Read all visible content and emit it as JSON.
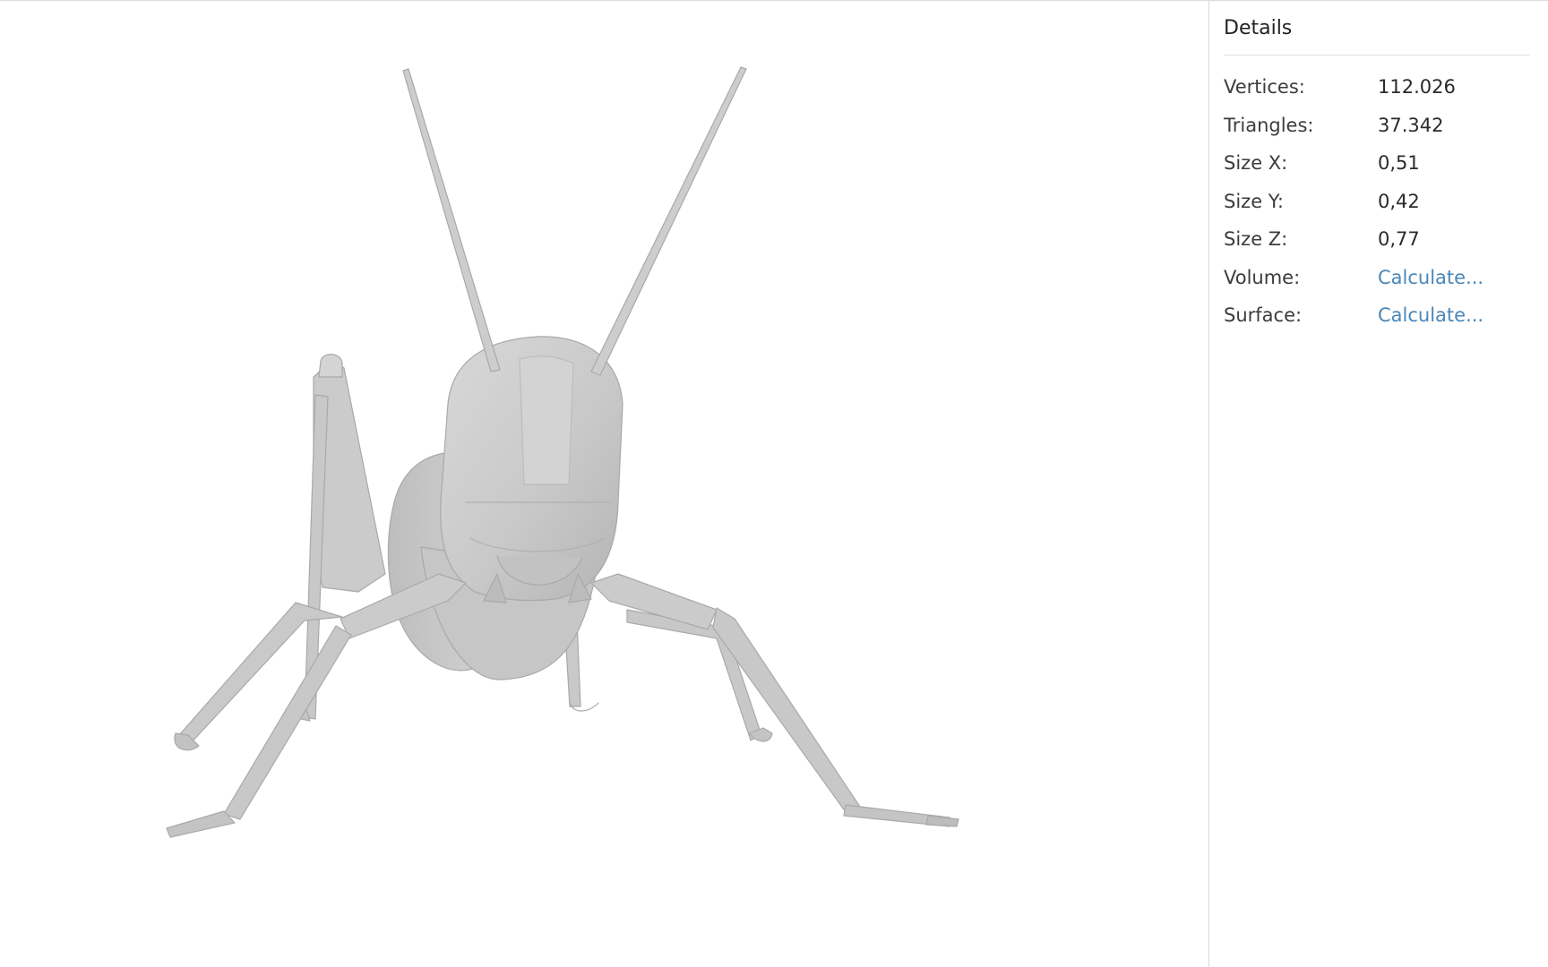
{
  "details": {
    "title": "Details",
    "rows": [
      {
        "label": "Vertices:",
        "value": "112.026"
      },
      {
        "label": "Triangles:",
        "value": "37.342"
      },
      {
        "label": "Size X:",
        "value": "0,51"
      },
      {
        "label": "Size Y:",
        "value": "0,42"
      },
      {
        "label": "Size Z:",
        "value": "0,77"
      },
      {
        "label": "Volume:",
        "value": "Calculate..."
      },
      {
        "label": "Surface:",
        "value": "Calculate..."
      }
    ]
  },
  "viewport": {
    "model_color": "#cfcfcf",
    "model_shade": "#b3b3b3",
    "model_icon": "grasshopper-3d-model"
  },
  "colors": {
    "link": "#4a87b8",
    "divider": "#d9d9d9"
  }
}
